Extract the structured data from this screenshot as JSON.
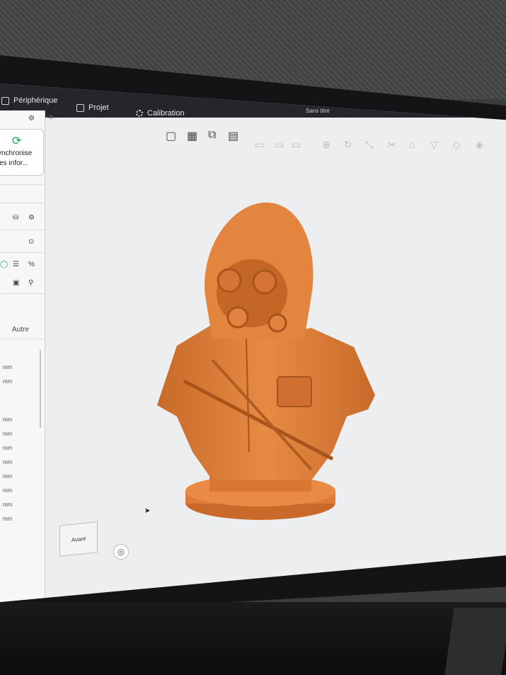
{
  "app": {
    "tabs": [
      {
        "label": "Périphérique"
      },
      {
        "label": "Projet"
      },
      {
        "label": "Calibration"
      }
    ],
    "document_title": "Sans titre"
  },
  "sidebar": {
    "sync_label_line1": "ynchronise",
    "sync_label_line2": "les infor...",
    "other_label": "Autre",
    "units": [
      "mm",
      "mm",
      "mm",
      "mm",
      "mm",
      "mm",
      "mm",
      "mm",
      "mm",
      "mm"
    ]
  },
  "viewport": {
    "view_cube_label": "Avant",
    "panel_toggle": "<b"
  },
  "colors": {
    "model": "#e07f3a",
    "accent_green": "#1f9d55",
    "bed": "#2d2f35"
  }
}
